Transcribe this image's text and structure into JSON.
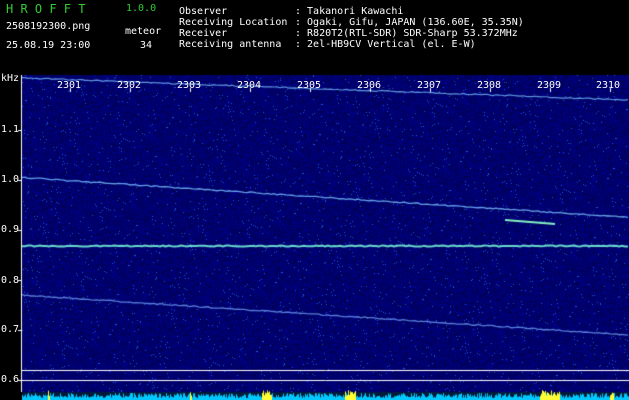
{
  "header": {
    "app_name": "H R O F F T",
    "version": "1.0.0",
    "filename": "2508192300.png",
    "meteor_label": "meteor",
    "meteor_count": "34",
    "datetime": "25.08.19 23:00"
  },
  "info": [
    {
      "label": "Observer",
      "value": ": Takanori Kawachi"
    },
    {
      "label": "Receiving Location",
      "value": ": Ogaki, Gifu, JAPAN (136.60E, 35.35N)"
    },
    {
      "label": "Receiver",
      "value": ": R820T2(RTL-SDR) SDR-Sharp 53.372MHz"
    },
    {
      "label": "Receiving antenna",
      "value": ": 2el-HB9CV Vertical (el. E-W)"
    }
  ],
  "axis": {
    "y_unit": "kHz",
    "y_ticks": [
      "1.1",
      "1.0",
      "0.9",
      "0.8",
      "0.7",
      "0.6"
    ],
    "x_ticks": [
      "2301",
      "2302",
      "2303",
      "2304",
      "2305",
      "2306",
      "2307",
      "2308",
      "2309",
      "2310"
    ]
  },
  "colors": {
    "background": "#000000",
    "header_green": "#33cc33",
    "spectrum_blue": "#0a0a6e",
    "signal": "#7fd8ff",
    "bottom_bar": "#00c8ff"
  }
}
